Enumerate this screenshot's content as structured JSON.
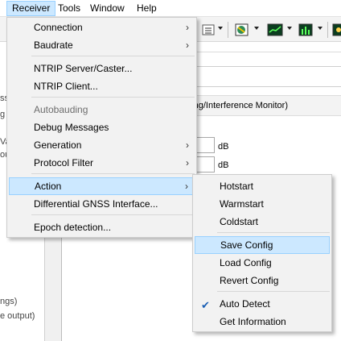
{
  "menubar": {
    "items": [
      {
        "label": "Receiver"
      },
      {
        "label": "Tools"
      },
      {
        "label": "Window"
      },
      {
        "label": "Help"
      }
    ]
  },
  "background": {
    "left_fragments": [
      "ss",
      "g",
      "Va",
      "ou",
      "ngs)",
      "e output)"
    ],
    "panel_title_fragment": "ming/Interference Monitor)",
    "unit_1": "dB",
    "unit_2": "dB"
  },
  "receiver_menu": {
    "items": [
      {
        "label": "Connection",
        "submenu": true
      },
      {
        "label": "Baudrate",
        "submenu": true
      },
      {
        "label": "NTRIP Server/Caster..."
      },
      {
        "label": "NTRIP Client..."
      },
      {
        "label": "Autobauding",
        "disabled": true
      },
      {
        "label": "Debug Messages"
      },
      {
        "label": "Generation",
        "submenu": true
      },
      {
        "label": "Protocol Filter",
        "submenu": true
      },
      {
        "label": "Action",
        "submenu": true,
        "highlighted": true
      },
      {
        "label": "Differential GNSS Interface..."
      },
      {
        "label": "Epoch detection..."
      }
    ],
    "submenu_arrow": "›"
  },
  "action_submenu": {
    "items": [
      {
        "label": "Hotstart"
      },
      {
        "label": "Warmstart"
      },
      {
        "label": "Coldstart"
      },
      {
        "label": "Save Config",
        "highlighted": true
      },
      {
        "label": "Load Config"
      },
      {
        "label": "Revert Config"
      },
      {
        "label": "Auto Detect",
        "checked": true
      },
      {
        "label": "Get Information"
      }
    ],
    "check_glyph": "✔"
  }
}
